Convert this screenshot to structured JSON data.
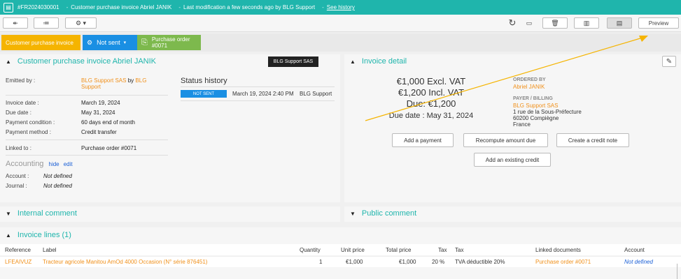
{
  "topbar": {
    "ref": "#FR2024030001",
    "title": "Customer purchase invoice Abriel JANIK",
    "modified": "Last modification a few seconds ago by BLG Support",
    "history_link": "See history"
  },
  "toolbar": {
    "back": "↞",
    "list": "≔",
    "preview": "Preview"
  },
  "status": {
    "type_label": "Customer purchase invoice",
    "state_label": "Not sent",
    "purchase_order_label": "Purchase order",
    "purchase_order_num": "#0071"
  },
  "customer_panel": {
    "title": "Customer purchase invoice Abriel JANIK",
    "company_badge": "BLG Support SAS",
    "emitted_by_label": "Emitted by :",
    "emitted_by_company": "BLG Support SAS",
    "emitted_by_word": "by",
    "emitted_by_person": "BLG Support",
    "invoice_date_label": "Invoice date :",
    "invoice_date": "March 19, 2024",
    "due_date_label": "Due date :",
    "due_date": "May 31, 2024",
    "payment_condition_label": "Payment condition :",
    "payment_condition": "60 days end of month",
    "payment_method_label": "Payment method :",
    "payment_method": "Credit transfer",
    "linked_to_label": "Linked to :",
    "linked_to": "Purchase order #0071",
    "accounting_title": "Accounting",
    "hide": "hide",
    "edit": "edit",
    "account_label": "Account :",
    "account_value": "Not defined",
    "journal_label": "Journal :",
    "journal_value": "Not defined",
    "status_history_title": "Status history",
    "history_state": "NOT SENT",
    "history_date": "March 19, 2024 2:40 PM",
    "history_user": "BLG Support"
  },
  "invoice_detail": {
    "title": "Invoice detail",
    "excl_vat": "€1,000 Excl. VAT",
    "incl_vat": "€1,200 Incl. VAT",
    "due": "Due: €1,200",
    "due_date": "Due date : May 31, 2024",
    "ordered_by_label": "ORDERED BY",
    "ordered_by": "Abriel JANIK",
    "payer_label": "PAYER / BILLING",
    "payer_company": "BLG Support SAS",
    "address1": "1 rue de la Sous-Préfecture",
    "address2": "60200 Compiègne",
    "country": "France",
    "add_payment": "Add a payment",
    "recompute": "Recompute amount due",
    "credit_note": "Create a credit note",
    "existing_credit": "Add an existing credit"
  },
  "comments": {
    "internal": "Internal comment",
    "public": "Public comment"
  },
  "lines": {
    "title": "Invoice lines (1)",
    "headers": {
      "reference": "Reference",
      "label": "Label",
      "quantity": "Quantity",
      "unit_price": "Unit price",
      "total_price": "Total price",
      "tax": "Tax",
      "tax_name": "Tax",
      "linked": "Linked documents",
      "account": "Account"
    },
    "row": {
      "reference": "LFEAIVUZ",
      "label": "Tracteur agricole Manitou AmOd 4000 Occasion (N° série 876451)",
      "quantity": "1",
      "unit_price": "€1,000",
      "total_price": "€1,000",
      "tax": "20 %",
      "tax_name": "TVA déductible 20%",
      "linked": "Purchase order #0071",
      "account": "Not defined"
    }
  },
  "colors": {
    "teal": "#1fb5ac",
    "orange": "#f0901a",
    "yellow": "#f5b400",
    "blue": "#1a8fe3",
    "green": "#7db94d",
    "annotation_arrow": "#f5b400"
  }
}
